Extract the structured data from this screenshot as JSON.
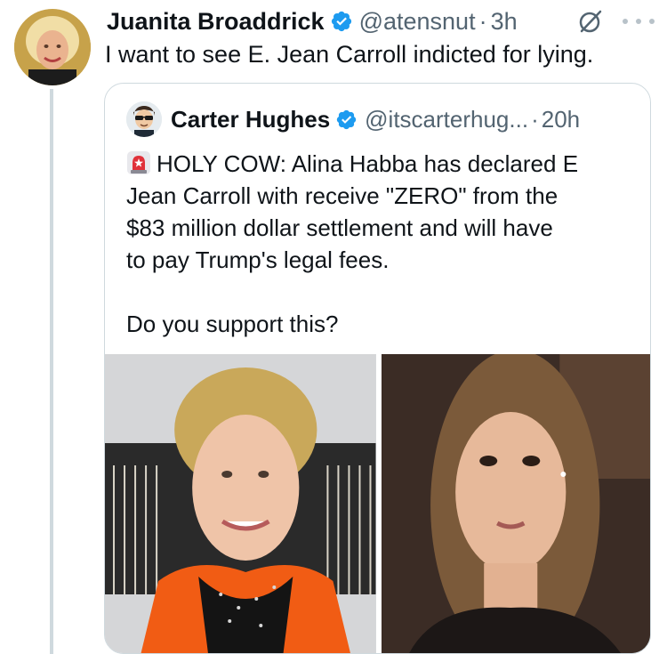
{
  "tweet": {
    "author_name": "Juanita Broaddrick",
    "handle": "@atensnut",
    "separator": "·",
    "time": "3h",
    "text": "I want to see E. Jean Carroll indicted for lying.",
    "icons": {
      "avatar": "profile-photo",
      "verified": "verified-badge-icon",
      "grok": "grok-icon",
      "more": "more-options-icon"
    }
  },
  "quote": {
    "author_name": "Carter Hughes",
    "handle": "@itscarterhug...",
    "separator": "·",
    "time": "20h",
    "lines": [
      "HOLY COW: Alina Habba has declared E",
      "Jean Carroll with receive \"ZERO\" from the",
      "$83 million dollar settlement and will have",
      "to pay Trump's legal fees."
    ],
    "question": "Do you support this?",
    "icons": {
      "siren": "siren-emoji-icon",
      "avatar": "cartoon-avatar-with-sunglasses"
    }
  },
  "colors": {
    "verified_blue": "#1d9bf0",
    "secondary_text": "#536471",
    "border": "#cfd9de"
  }
}
